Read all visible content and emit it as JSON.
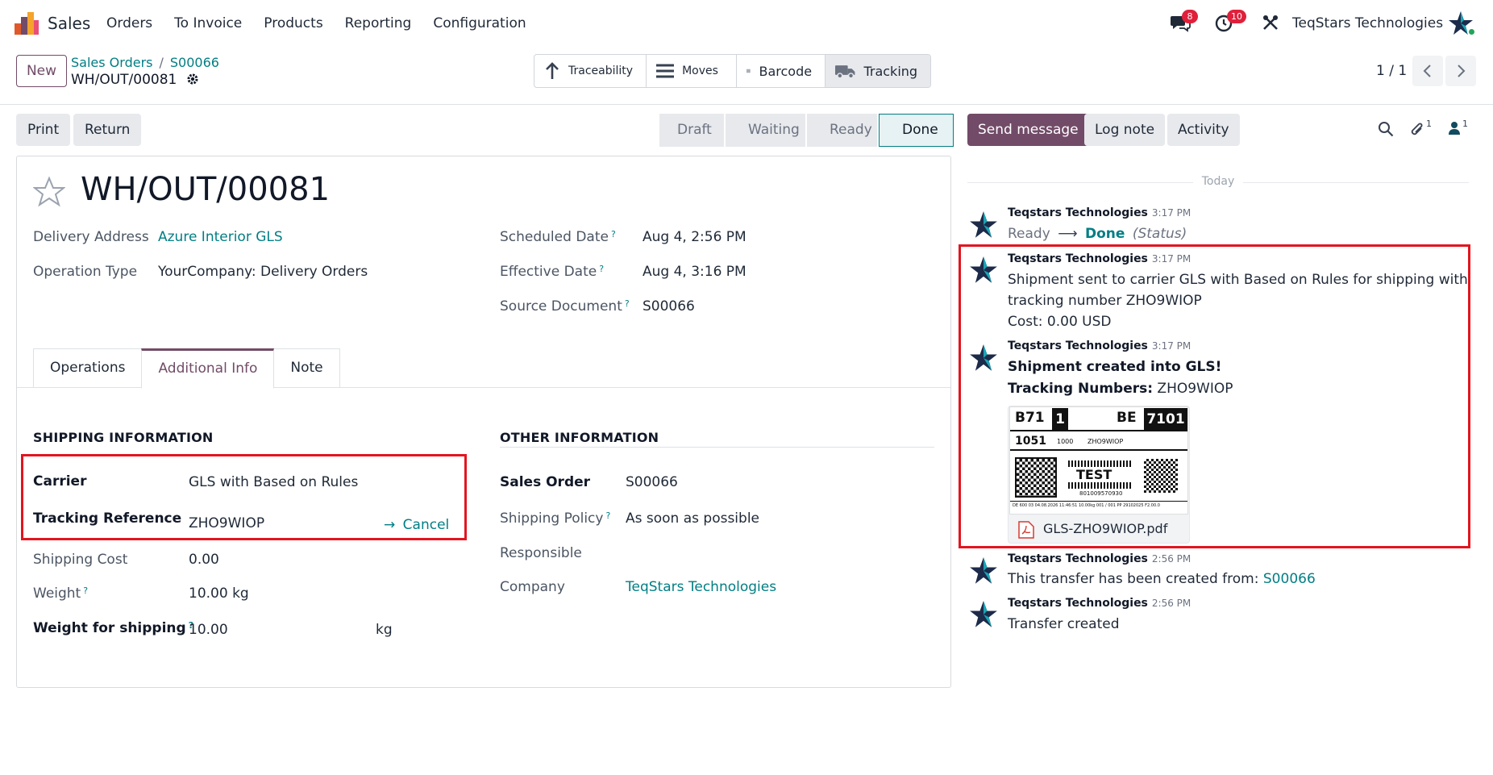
{
  "navbar": {
    "app_name": "Sales",
    "menu": [
      "Orders",
      "To Invoice",
      "Products",
      "Reporting",
      "Configuration"
    ],
    "messages_badge": "8",
    "activities_badge": "10",
    "company": "TeqStars Technologies"
  },
  "control_panel": {
    "new_label": "New",
    "breadcrumb": [
      "Sales Orders",
      "S00066"
    ],
    "record": "WH/OUT/00081",
    "smart_buttons": [
      "Traceability",
      "Moves",
      "Barcode",
      "Tracking"
    ],
    "pager": "1 / 1"
  },
  "actions": {
    "print": "Print",
    "return": "Return",
    "stages": [
      "Draft",
      "Waiting",
      "Ready",
      "Done"
    ],
    "active_stage": "Done",
    "send_message": "Send message",
    "log_note": "Log note",
    "activity": "Activity",
    "attachments_count": "1",
    "followers_count": "1"
  },
  "form": {
    "name": "WH/OUT/00081",
    "delivery_address_label": "Delivery Address",
    "delivery_address": "Azure Interior GLS",
    "operation_type_label": "Operation Type",
    "operation_type": "YourCompany: Delivery Orders",
    "scheduled_date_label": "Scheduled Date",
    "scheduled_date": "Aug 4, 2:56 PM",
    "effective_date_label": "Effective Date",
    "effective_date": "Aug 4, 3:16 PM",
    "source_document_label": "Source Document",
    "source_document": "S00066",
    "tabs": [
      "Operations",
      "Additional Info",
      "Note"
    ],
    "active_tab": "Additional Info",
    "shipping_title": "SHIPPING INFORMATION",
    "carrier_label": "Carrier",
    "carrier": "GLS with Based on Rules",
    "tracking_label": "Tracking Reference",
    "tracking": "ZHO9WIOP",
    "cancel_label": "Cancel",
    "shipping_cost_label": "Shipping Cost",
    "shipping_cost": "0.00",
    "weight_label": "Weight",
    "weight": "10.00",
    "weight_unit": "kg",
    "weight_shipping_label": "Weight for shipping",
    "weight_shipping": "10.00",
    "weight_shipping_unit": "kg",
    "other_title": "OTHER INFORMATION",
    "sales_order_label": "Sales Order",
    "sales_order": "S00066",
    "shipping_policy_label": "Shipping Policy",
    "shipping_policy": "As soon as possible",
    "responsible_label": "Responsible",
    "company_label": "Company",
    "company": "TeqStars Technologies"
  },
  "chatter": {
    "today": "Today",
    "messages": [
      {
        "author": "Teqstars Technologies",
        "time": "3:17 PM",
        "from": "Ready",
        "to": "Done",
        "field": "(Status)"
      },
      {
        "author": "Teqstars Technologies",
        "time": "3:17 PM",
        "line1": "Shipment sent to carrier GLS with Based on Rules for shipping with",
        "line2": "tracking number ZHO9WIOP",
        "line3": "Cost: 0.00 USD"
      },
      {
        "author": "Teqstars Technologies",
        "time": "3:17 PM",
        "line1": "Shipment created into GLS!",
        "line2_bold": "Tracking Numbers:",
        "line2": " ZHO9WIOP",
        "attachment": "GLS-ZHO9WIOP.pdf"
      },
      {
        "author": "Teqstars Technologies",
        "time": "2:56 PM",
        "line1": "This transfer has been created from:",
        "link": "S00066"
      },
      {
        "author": "Teqstars Technologies",
        "time": "2:56 PM",
        "line1": "Transfer created"
      }
    ],
    "label_preview": {
      "route": "B71",
      "box": "1",
      "country": "BE",
      "zip": "7101",
      "depot": "1051",
      "sub": "1000",
      "ref": "ZHO9WIOP",
      "stamp": "TEST",
      "number": "801009570930",
      "footer": "DE 600  03   04.08.2026   11:46:51   10.00kg   001 / 001   PP   29102025   F2.00.0"
    }
  }
}
